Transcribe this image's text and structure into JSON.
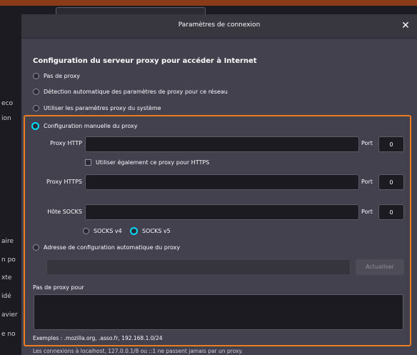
{
  "dialog": {
    "title": "Paramètres de connexion",
    "close_glyph": "✕"
  },
  "background": {
    "fragments": [
      "eco",
      "ion",
      "aire",
      "n po",
      "xte",
      "idé",
      "avier",
      "e no"
    ]
  },
  "proxy": {
    "section_title": "Configuration du serveur proxy pour accéder à Internet",
    "options": {
      "none": "Pas de proxy",
      "auto_detect": "Détection automatique des paramètres de proxy pour ce réseau",
      "system": "Utiliser les paramètres proxy du système",
      "manual": "Configuration manuelle du proxy",
      "auto_url": "Adresse de configuration automatique du proxy"
    },
    "selected": "manual",
    "http": {
      "label": "Proxy HTTP",
      "value": "",
      "port_label": "Port",
      "port_value": "0"
    },
    "use_for_https_label": "Utiliser également ce proxy pour HTTPS",
    "https": {
      "label": "Proxy HTTPS",
      "value": "",
      "port_label": "Port",
      "port_value": "0"
    },
    "socks": {
      "label": "Hôte SOCKS",
      "value": "",
      "port_label": "Port",
      "port_value": "0"
    },
    "socks_v4_label": "SOCKS v4",
    "socks_v5_label": "SOCKS v5",
    "socks_selected": "v5",
    "auto_url_value": "",
    "update_button": "Actualiser",
    "no_proxy_label": "Pas de proxy pour",
    "no_proxy_value": "",
    "examples": "Exemples : .mozilla.org, .asso.fr, 192.168.1.0/24",
    "localhost_note": "Les connexions à localhost, 127.0.0.1/8 ou ::1 ne passent jamais par un proxy."
  },
  "colors": {
    "accent": "#00ddff",
    "highlight_border": "#f07c22",
    "dialog_bg": "#42414d",
    "input_bg": "#1c1b22"
  }
}
